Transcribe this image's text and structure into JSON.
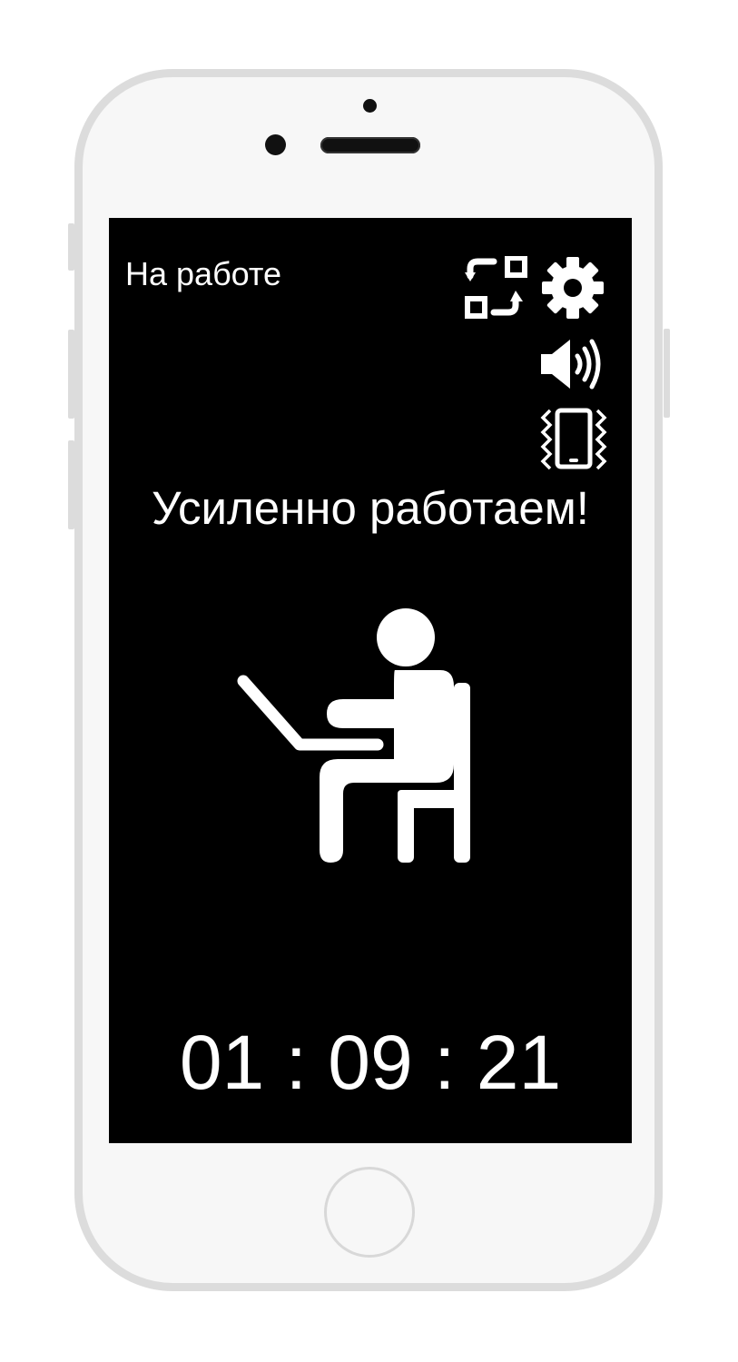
{
  "screen": {
    "mode_label": "На работе",
    "status_text": "Усиленно работаем!",
    "timer": {
      "hours": "01",
      "minutes": "09",
      "seconds": "21",
      "separator": ":"
    }
  },
  "icons": {
    "switch": "switch-mode-icon",
    "settings": "gear-icon",
    "sound": "speaker-volume-icon",
    "vibration": "phone-vibrate-icon",
    "illustration": "person-working-at-laptop-icon"
  },
  "colors": {
    "screen_background": "#000000",
    "foreground": "#ffffff",
    "phone_body": "#f7f7f7",
    "phone_frame": "#dcdcdc"
  }
}
